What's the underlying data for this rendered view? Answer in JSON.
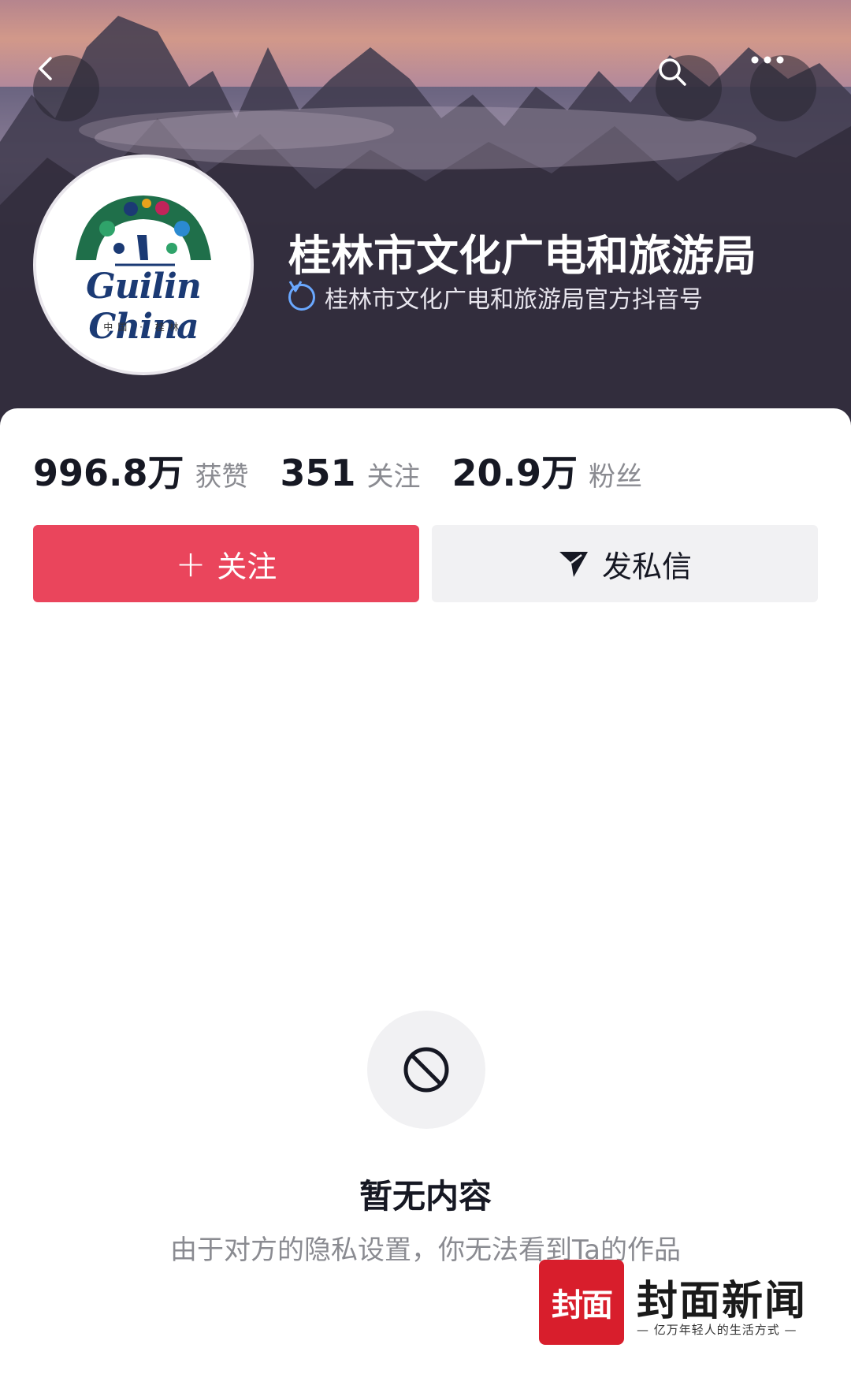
{
  "header": {
    "back_icon": "chevron-left-icon",
    "search_icon": "search-icon",
    "more_icon": "more-horizontal-icon"
  },
  "profile": {
    "avatar_logo_text": "Guilin China",
    "avatar_logo_sub": "中国 · 桂林",
    "name": "桂林市文化广电和旅游局",
    "verified_badge_icon": "verified-v-icon",
    "verified_text": "桂林市文化广电和旅游局官方抖音号"
  },
  "stats": [
    {
      "value": "996.8万",
      "label": "获赞"
    },
    {
      "value": "351",
      "label": "关注"
    },
    {
      "value": "20.9万",
      "label": "粉丝"
    }
  ],
  "actions": {
    "follow_plus": "+",
    "follow_label": "关注",
    "message_icon": "send-icon",
    "message_label": "发私信",
    "follow_color": "#ea455c"
  },
  "empty_state": {
    "icon": "prohibited-icon",
    "title": "暂无内容",
    "description": "由于对方的隐私设置，你无法看到Ta的作品"
  },
  "watermark": {
    "logo_text": "封面",
    "name": "封面新闻",
    "slogan": "— 亿万年轻人的生活方式 —",
    "logo_color": "#d81e2c"
  }
}
